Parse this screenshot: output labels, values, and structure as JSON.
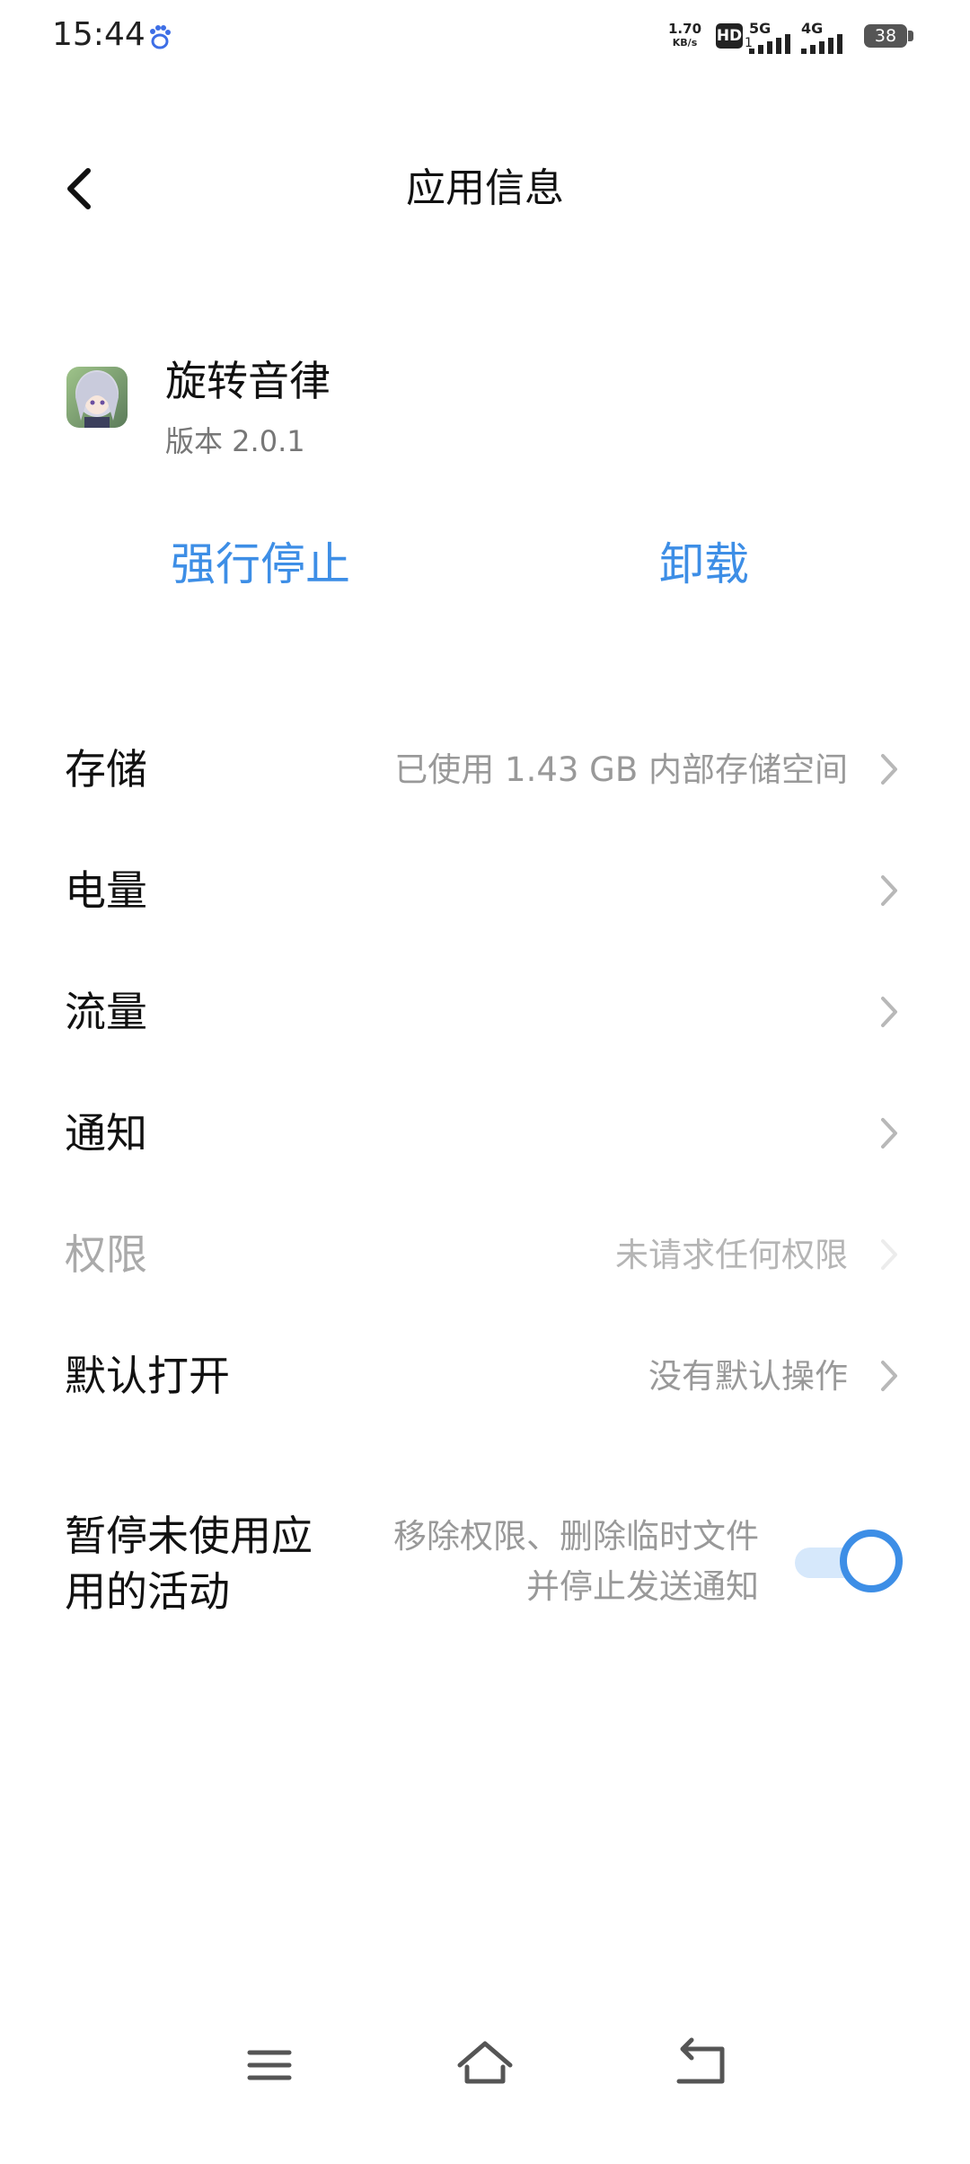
{
  "status_bar": {
    "time": "15:44",
    "speed_value": "1.70",
    "speed_unit": "KB/s",
    "hd": "HD",
    "hd_sub": "1",
    "net1": "5G",
    "net2": "4G",
    "battery": "38"
  },
  "header": {
    "title": "应用信息"
  },
  "app": {
    "name": "旋转音律",
    "version": "版本 2.0.1"
  },
  "actions": {
    "force_stop": "强行停止",
    "uninstall": "卸载"
  },
  "settings": {
    "storage": {
      "label": "存储",
      "value": "已使用 1.43 GB 内部存储空间"
    },
    "battery": {
      "label": "电量",
      "value": ""
    },
    "data": {
      "label": "流量",
      "value": ""
    },
    "notifications": {
      "label": "通知",
      "value": ""
    },
    "permissions": {
      "label": "权限",
      "value": "未请求任何权限"
    },
    "open_by_default": {
      "label": "默认打开",
      "value": "没有默认操作"
    },
    "pause_activity": {
      "label": "暂停未使用应用的活动",
      "description": "移除权限、删除临时文件并停止发送通知",
      "enabled": true
    }
  },
  "colors": {
    "accent": "#3d8ee6",
    "secondary_text": "#999999"
  }
}
